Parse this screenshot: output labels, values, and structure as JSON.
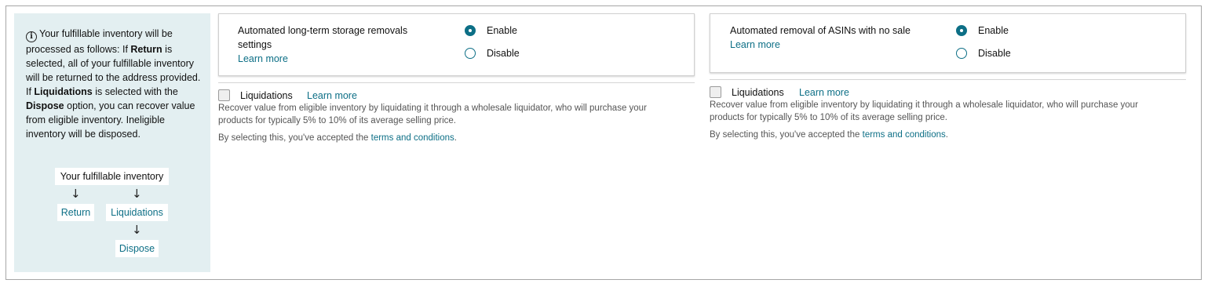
{
  "info": {
    "text_parts": [
      "Your fulfillable inventory will be processed as follows: If ",
      "Return",
      " is selected, all of your fulfillable inventory will be returned to the address provided. If ",
      "Liquidations",
      " is selected with the ",
      "Dispose",
      " option, you can recover value from eligible inventory. Ineligible inventory will be disposed."
    ],
    "flow": {
      "root": "Your fulfillable inventory",
      "return": "Return",
      "liquidations": "Liquidations",
      "dispose": "Dispose",
      "arrow": "↓"
    }
  },
  "panels": [
    {
      "title_line1": "Automated long-term storage removals",
      "title_line2": "settings",
      "learn_more": "Learn more",
      "enable_label": "Enable",
      "disable_label": "Disable",
      "selected": "Enable",
      "liquidations_label": "Liquidations",
      "liquidations_learn_more": "Learn more",
      "liquidations_checked": false,
      "description_line1": "Recover value from eligible inventory by liquidating it through a wholesale liquidator, who will purchase your",
      "description_line2": "products for typically 5% to 10% of its average selling price.",
      "terms_prefix": "By selecting this, you've accepted the ",
      "terms_link": "terms and conditions",
      "terms_suffix": "."
    },
    {
      "title_line1": "Automated removal of ASINs with no sale",
      "learn_more": "Learn more",
      "enable_label": "Enable",
      "disable_label": "Disable",
      "selected": "Enable",
      "liquidations_label": "Liquidations",
      "liquidations_learn_more": "Learn more",
      "liquidations_checked": false,
      "description_line1": "Recover value from eligible inventory by liquidating it through a wholesale liquidator, who will purchase your",
      "description_line2": "products for typically 5% to 10% of its average selling price.",
      "terms_prefix": "By selecting this, you've accepted the ",
      "terms_link": "terms and conditions",
      "terms_suffix": "."
    }
  ],
  "colors": {
    "accent": "#0d6f86",
    "info_background": "#e3eff1",
    "border": "#a6a6a6"
  }
}
